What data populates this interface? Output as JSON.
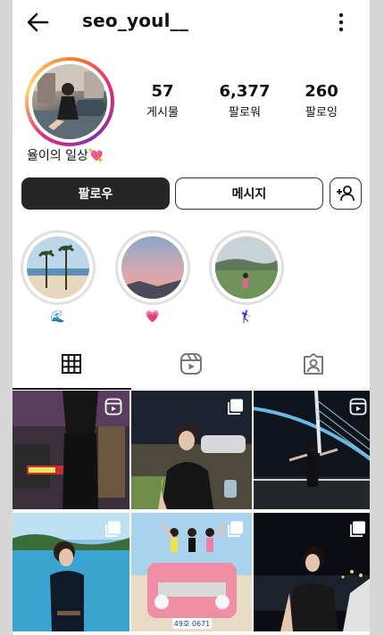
{
  "profile": {
    "username": "seo_youl__",
    "bio": "율이의 일상💘"
  },
  "stats": [
    {
      "number": "57",
      "label": "게시물"
    },
    {
      "number": "6,377",
      "label": "팔로워"
    },
    {
      "number": "260",
      "label": "팔로잉"
    }
  ],
  "buttons": {
    "follow": "팔로우",
    "message": "메시지"
  },
  "highlights": [
    {
      "label": "🌊"
    },
    {
      "label": "💗"
    },
    {
      "label": "🏌🏻‍♀️"
    }
  ],
  "icons": {
    "back": "back-arrow-icon",
    "more": "more-vertical-icon",
    "add_user": "add-user-icon",
    "grid": "grid-icon",
    "reels": "reels-icon",
    "tagged": "tagged-icon",
    "reel_badge": "reel-badge-icon",
    "multi_badge": "carousel-badge-icon"
  },
  "posts": [
    {
      "badge": "reel"
    },
    {
      "badge": "carousel"
    },
    {
      "badge": "reel"
    },
    {
      "badge": "carousel"
    },
    {
      "badge": "carousel"
    },
    {
      "badge": "carousel"
    }
  ],
  "photo_texts": {
    "license_plate": "49호 0671"
  },
  "colors": {
    "follow_button": "#262626",
    "ring_start": "#f58529",
    "ring_end": "#dd2a7b"
  }
}
